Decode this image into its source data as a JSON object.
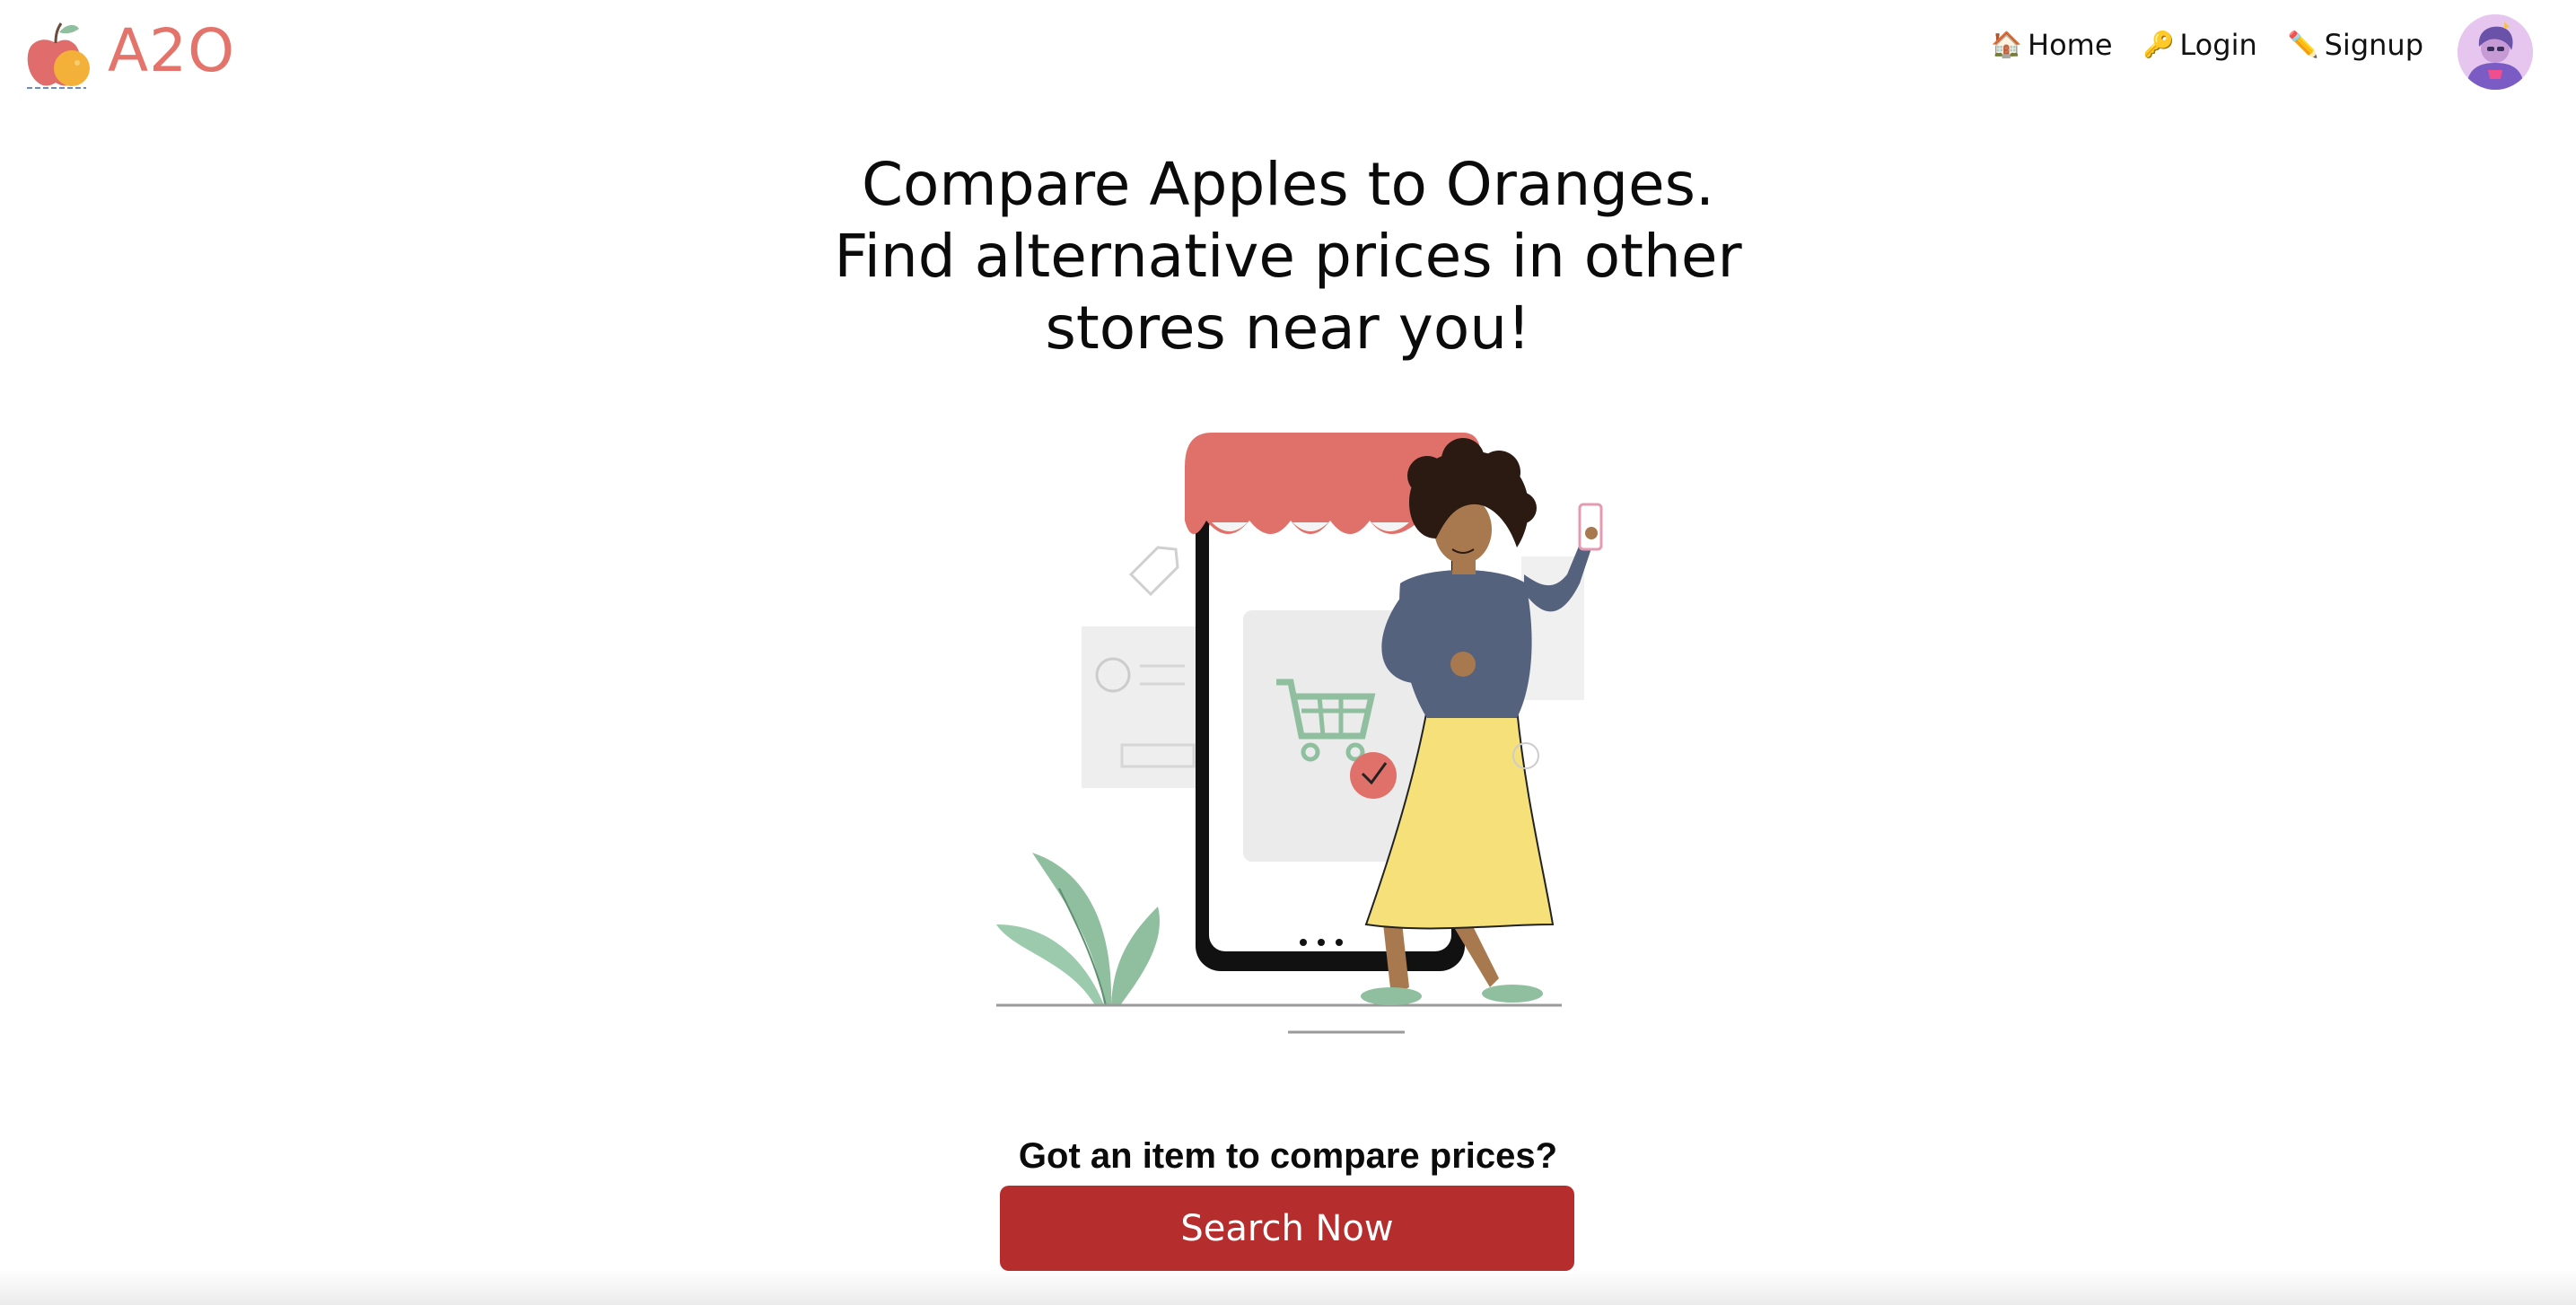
{
  "header": {
    "logo_text": "A2O",
    "nav": [
      {
        "icon": "🏠",
        "icon_name": "house-icon",
        "label": "Home"
      },
      {
        "icon": "🔑",
        "icon_name": "key-icon",
        "label": "Login"
      },
      {
        "icon": "✏️",
        "icon_name": "pencil-icon",
        "label": "Signup"
      }
    ]
  },
  "hero": {
    "headline_lines": [
      "Compare Apples to Oranges.",
      "Find alternative prices in other",
      "stores near you!"
    ]
  },
  "cta": {
    "prompt": "Got an item to compare prices?",
    "button_label": "Search Now"
  },
  "colors": {
    "brand": "#e4736b",
    "button": "#b52d2c",
    "awning": "#e0716a",
    "plant": "#8fbf9f",
    "skirt": "#f5e07a",
    "sweater": "#55627e"
  }
}
